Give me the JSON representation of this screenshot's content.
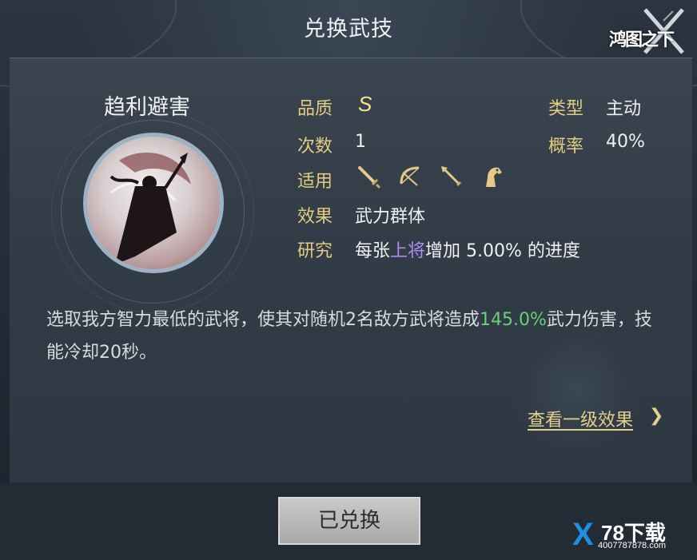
{
  "header": {
    "title": "兑换武技",
    "logo_text": "鸿图之下"
  },
  "skill": {
    "name": "趋利避害",
    "stats": {
      "quality_label": "品质",
      "quality_value": "S",
      "type_label": "类型",
      "type_value": "主动",
      "count_label": "次数",
      "count_value": "1",
      "rate_label": "概率",
      "rate_value": "40%",
      "apply_label": "适用",
      "apply_icons": [
        "sword-icon",
        "bow-icon",
        "spear-icon",
        "horse-icon"
      ],
      "effect_label": "效果",
      "effect_value": "武力群体",
      "research_label": "研究",
      "research_prefix": "每张",
      "research_highlight": "上将",
      "research_suffix": "增加 5.00% 的进度"
    },
    "description": {
      "part1": "选取我方智力最低的武将，使其对随机2名敌方武将造成",
      "highlight": "145.0%",
      "part2": "武力伤害，技能冷却20秒。"
    },
    "link_label": "查看一级效果",
    "link_chevron": "❯"
  },
  "actions": {
    "exchanged_button": "已兑换"
  },
  "watermark": {
    "mark": "X",
    "title": "78下载",
    "site": "4007787878.com"
  },
  "colors": {
    "label_gold": "#e3cc82",
    "highlight_purple": "#b08bf2",
    "highlight_green": "#6bcf7a",
    "button_gray": "#b9b9b9"
  }
}
